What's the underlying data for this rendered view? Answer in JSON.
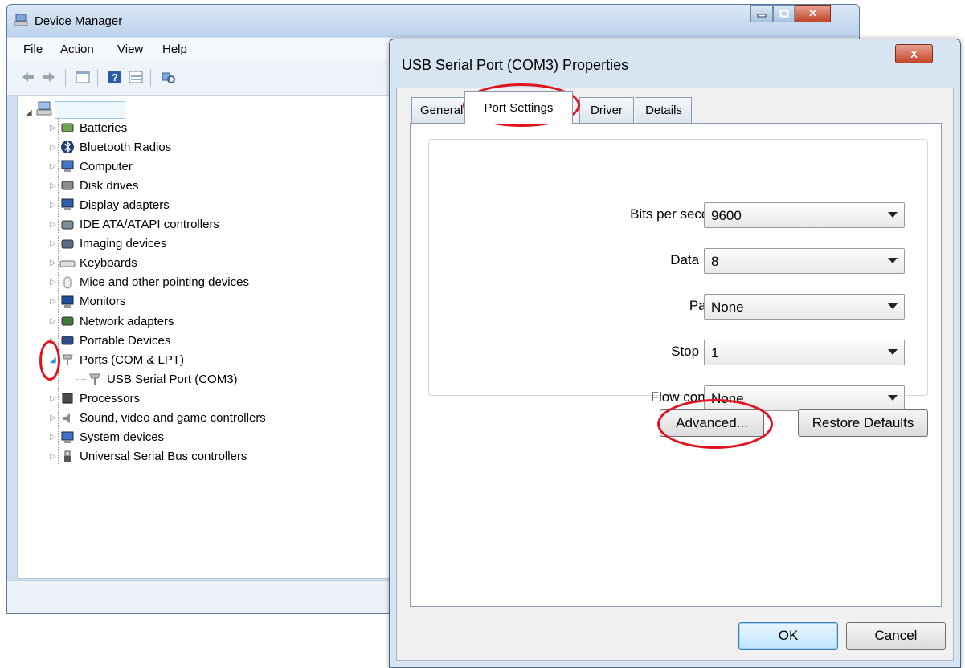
{
  "device_manager": {
    "title": "Device Manager",
    "menu": [
      "File",
      "Action",
      "View",
      "Help"
    ],
    "tree": [
      {
        "label": "Batteries",
        "icon": "battery-icon",
        "expander": "collapsed"
      },
      {
        "label": "Bluetooth Radios",
        "icon": "bluetooth-icon",
        "expander": "collapsed"
      },
      {
        "label": "Computer",
        "icon": "computer-icon",
        "expander": "collapsed"
      },
      {
        "label": "Disk drives",
        "icon": "disk-drive-icon",
        "expander": "collapsed"
      },
      {
        "label": "Display adapters",
        "icon": "display-adapter-icon",
        "expander": "collapsed"
      },
      {
        "label": "IDE ATA/ATAPI controllers",
        "icon": "ide-controller-icon",
        "expander": "collapsed"
      },
      {
        "label": "Imaging devices",
        "icon": "camera-icon",
        "expander": "collapsed"
      },
      {
        "label": "Keyboards",
        "icon": "keyboard-icon",
        "expander": "collapsed"
      },
      {
        "label": "Mice and other pointing devices",
        "icon": "mouse-icon",
        "expander": "collapsed"
      },
      {
        "label": "Monitors",
        "icon": "monitor-icon",
        "expander": "collapsed"
      },
      {
        "label": "Network adapters",
        "icon": "network-adapter-icon",
        "expander": "collapsed"
      },
      {
        "label": "Portable Devices",
        "icon": "portable-device-icon",
        "expander": "collapsed"
      },
      {
        "label": "Ports (COM & LPT)",
        "icon": "port-icon",
        "expander": "expanded"
      },
      {
        "label": "USB Serial Port (COM3)",
        "icon": "port-icon",
        "expander": "none",
        "child": true
      },
      {
        "label": "Processors",
        "icon": "processor-icon",
        "expander": "collapsed"
      },
      {
        "label": "Sound, video and game controllers",
        "icon": "speaker-icon",
        "expander": "collapsed"
      },
      {
        "label": "System devices",
        "icon": "computer-icon",
        "expander": "collapsed"
      },
      {
        "label": "Universal Serial Bus controllers",
        "icon": "usb-icon",
        "expander": "collapsed"
      }
    ]
  },
  "dialog": {
    "title": "USB Serial Port (COM3) Properties",
    "tabs": [
      "General",
      "Port Settings",
      "Driver",
      "Details"
    ],
    "active_tab": "Port Settings",
    "fields": [
      {
        "label": "Bits per second:",
        "value": "9600"
      },
      {
        "label": "Data bits:",
        "value": "8"
      },
      {
        "label": "Parity:",
        "value": "None"
      },
      {
        "label": "Stop bits:",
        "value": "1"
      },
      {
        "label": "Flow control:",
        "value": "None"
      }
    ],
    "advanced_label": "Advanced...",
    "restore_label": "Restore Defaults",
    "ok_label": "OK",
    "cancel_label": "Cancel",
    "close_glyph": "X"
  },
  "colors": {
    "annotation_red": "#e0141e",
    "close_button": "#c4442b"
  }
}
